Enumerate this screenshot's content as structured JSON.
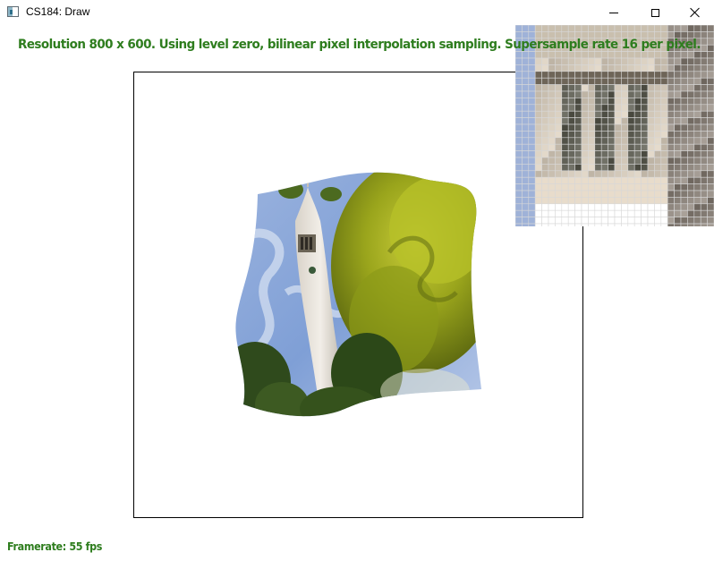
{
  "window": {
    "title": "CS184: Draw",
    "controls": {
      "minimize": "minimize",
      "maximize": "maximize",
      "close": "close"
    },
    "icon": "app-window-icon"
  },
  "status": {
    "settings_text": "Resolution 800 x 600. Using level zero, bilinear pixel interpolation sampling. Supersample rate 16 per pixel.",
    "framerate_text": "Framerate: 55 fps"
  },
  "colors": {
    "status_text": "#2e7d1e",
    "background": "#ffffff",
    "frame_border": "#000000"
  },
  "canvas": {
    "content": "warped texture of clock tower and tree",
    "zoom_inset": "pixel-level magnified view of tower windows"
  }
}
